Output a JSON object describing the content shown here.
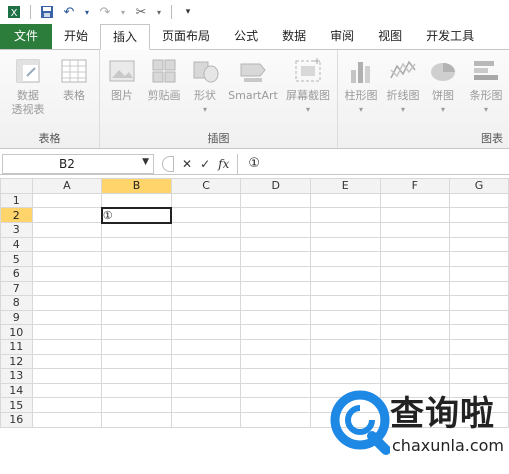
{
  "qat": {
    "icons": [
      "save-icon",
      "undo-icon",
      "redo-icon",
      "customize-icon"
    ]
  },
  "tabs": [
    {
      "label": "文件"
    },
    {
      "label": "开始"
    },
    {
      "label": "插入"
    },
    {
      "label": "页面布局"
    },
    {
      "label": "公式"
    },
    {
      "label": "数据"
    },
    {
      "label": "审阅"
    },
    {
      "label": "视图"
    },
    {
      "label": "开发工具"
    }
  ],
  "ribbon": {
    "groups": {
      "tables": {
        "label": "表格"
      },
      "illustrations": {
        "label": "插图"
      },
      "charts": {
        "label": "图表"
      }
    },
    "buttons": {
      "pivot_line1": "数据",
      "pivot_line2": "透视表",
      "table": "表格",
      "picture": "图片",
      "clipart": "剪贴画",
      "shapes": "形状",
      "smartart": "SmartArt",
      "screenshot": "屏幕截图",
      "column": "柱形图",
      "line": "折线图",
      "pie": "饼图",
      "bar": "条形图"
    }
  },
  "formula_bar": {
    "name_box": "B2",
    "fx": "fx",
    "value": "①"
  },
  "sheet": {
    "columns": [
      "A",
      "B",
      "C",
      "D",
      "E",
      "F",
      "G"
    ],
    "rows": [
      "1",
      "2",
      "3",
      "4",
      "5",
      "6",
      "7",
      "8",
      "9",
      "10",
      "11",
      "12",
      "13",
      "14",
      "15",
      "16"
    ],
    "active_cell_value": "①"
  },
  "watermark": {
    "text": "查询啦",
    "url": "chaxunla.com"
  }
}
